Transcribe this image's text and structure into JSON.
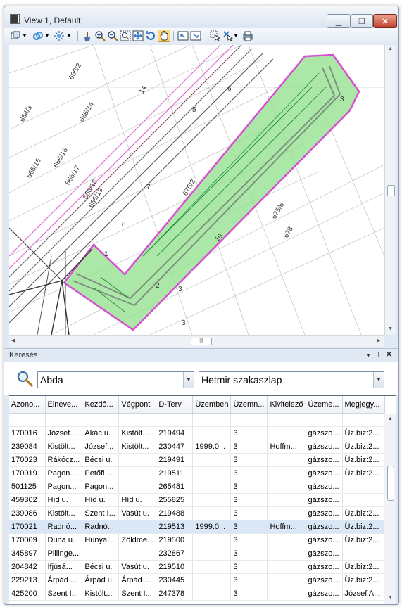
{
  "window": {
    "title": "View 1, Default"
  },
  "map": {
    "labels": [
      "666/2",
      "666/14",
      "666/16",
      "666/16",
      "666/17",
      "666/18",
      "666/19",
      "664/3",
      "675/2",
      "675/6",
      "678",
      "14",
      "6",
      "5",
      "7",
      "8",
      "1",
      "3",
      "10",
      "2",
      "3",
      "3"
    ]
  },
  "search": {
    "panel_title": "Keresés",
    "field1_value": "Abda",
    "field2_value": "Hetmir szakaszlap"
  },
  "table": {
    "columns": [
      "Azono...",
      "Elneve...",
      "Kezdő...",
      "Végpont",
      "D-Terv",
      "Üzemben",
      "Üzemn...",
      "Kivitelező",
      "Üzeme...",
      "Megjegy..."
    ],
    "rows": [
      [
        "170016",
        "József...",
        "Akác u.",
        "Kistölt...",
        "219494",
        "",
        "3",
        "",
        "gázszo...",
        "Üz.biz:2..."
      ],
      [
        "239084",
        "Kistölt...",
        "József...",
        "Kistölt...",
        "230447",
        "1999.0...",
        "3",
        "Hoffm...",
        "gázszo...",
        "Üz.biz:2..."
      ],
      [
        "170023",
        "Rákócz...",
        "Bécsi u.",
        "",
        "219491",
        "",
        "3",
        "",
        "gázszo...",
        "Üz.biz:2..."
      ],
      [
        "170019",
        "Pagon...",
        "Petőfi ...",
        "",
        "219511",
        "",
        "3",
        "",
        "gázszo...",
        "Üz.biz:2..."
      ],
      [
        "501125",
        "Pagon...",
        "Pagon...",
        "",
        "265481",
        "",
        "3",
        "",
        "gázszo...",
        ""
      ],
      [
        "459302",
        "Híd u.",
        "Híd u.",
        "Híd u.",
        "255825",
        "",
        "3",
        "",
        "gázszo...",
        ""
      ],
      [
        "239086",
        "Kistölt...",
        "Szent I...",
        "Vasút u.",
        "219488",
        "",
        "3",
        "",
        "gázszo...",
        "Üz.biz:2..."
      ],
      [
        "170021",
        "Radnó...",
        "Radnó...",
        "",
        "219513",
        "1999.0...",
        "3",
        "Hoffm...",
        "gázszo...",
        "Üz.biz:2..."
      ],
      [
        "170009",
        "Duna u.",
        "Hunya...",
        "Zöldme...",
        "219500",
        "",
        "3",
        "",
        "gázszo...",
        "Üz.biz:2..."
      ],
      [
        "345897",
        "Pillinge...",
        "",
        "",
        "232867",
        "",
        "3",
        "",
        "gázszo...",
        ""
      ],
      [
        "204842",
        "Ifjúsá...",
        "Bécsi u.",
        "Vasút u.",
        "219510",
        "",
        "3",
        "",
        "gázszo...",
        "Üz.biz:2..."
      ],
      [
        "229213",
        "Árpád ...",
        "Árpád u.",
        "Árpád ...",
        "230445",
        "",
        "3",
        "",
        "gázszo...",
        "Üz.biz:2..."
      ],
      [
        "425200",
        "Szent I...",
        "Kistölt...",
        "Szent I...",
        "247378",
        "",
        "3",
        "",
        "gázszo...",
        "József A..."
      ]
    ],
    "selected_row": 7
  }
}
